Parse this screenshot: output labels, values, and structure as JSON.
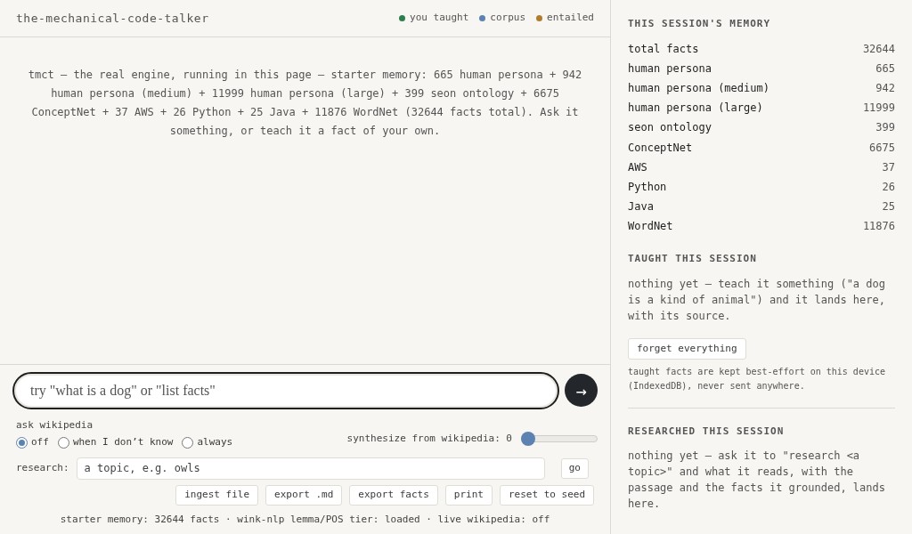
{
  "app_title": "the-mechanical-code-talker",
  "legend": [
    {
      "label": "you taught",
      "color": "#2e7d4f"
    },
    {
      "label": "corpus",
      "color": "#5b82b0"
    },
    {
      "label": "entailed",
      "color": "#b07d2e"
    }
  ],
  "intro": "tmct — the real engine, running in this page — starter memory: 665 human persona + 942 human persona (medium) + 11999 human persona (large) + 399 seon ontology + 6675 ConceptNet + 37 AWS + 26 Python + 25 Java + 11876 WordNet (32644 facts total). Ask it something, or teach it a fact of your own.",
  "ask": {
    "placeholder": "try \"what is a dog\" or \"list facts\"",
    "send": "→"
  },
  "wikipedia": {
    "label": "ask wikipedia",
    "options": [
      {
        "label": "off",
        "selected": true
      },
      {
        "label": "when I don’t know",
        "selected": false
      },
      {
        "label": "always",
        "selected": false
      }
    ]
  },
  "synthesize": {
    "label": "synthesize from wikipedia: 0",
    "level": 0
  },
  "research": {
    "label": "research:",
    "placeholder": "a topic, e.g. owls",
    "button": "go"
  },
  "actions": [
    "ingest file",
    "export .md",
    "export facts",
    "print",
    "reset to seed"
  ],
  "status_bar": "starter memory: 32644 facts · wink-nlp lemma/POS tier: loaded · live wikipedia: off",
  "memory": {
    "heading": "THIS SESSION'S MEMORY",
    "rows": [
      {
        "name": "total facts",
        "count": "32644"
      },
      {
        "name": "human persona",
        "count": "665"
      },
      {
        "name": "human persona (medium)",
        "count": "942"
      },
      {
        "name": "human persona (large)",
        "count": "11999"
      },
      {
        "name": "seon ontology",
        "count": "399"
      },
      {
        "name": "ConceptNet",
        "count": "6675"
      },
      {
        "name": "AWS",
        "count": "37"
      },
      {
        "name": "Python",
        "count": "26"
      },
      {
        "name": "Java",
        "count": "25"
      },
      {
        "name": "WordNet",
        "count": "11876"
      }
    ]
  },
  "taught": {
    "heading": "TAUGHT THIS SESSION",
    "text": "nothing yet — teach it something (\"a dog is a kind of animal\") and it lands here, with its source.",
    "button": "forget everything",
    "note": "taught facts are kept best-effort on this device (IndexedDB), never sent anywhere."
  },
  "researched": {
    "heading": "RESEARCHED THIS SESSION",
    "text": "nothing yet — ask it to \"research <a topic>\" and what it reads, with the passage and the facts it grounded, lands here."
  }
}
